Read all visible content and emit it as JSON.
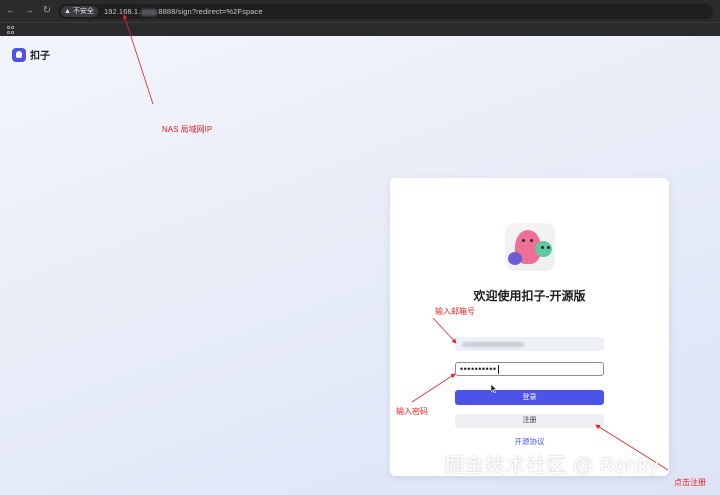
{
  "browser": {
    "insecure_label": "不安全",
    "url_prefix": "192.168.1.",
    "url_suffix": "8888/sign?redirect=%2Fspace"
  },
  "brand": {
    "name": "扣子"
  },
  "login": {
    "title": "欢迎使用扣子-开源版",
    "password_mask": "••••••••••",
    "login_label": "登录",
    "register_label": "注册",
    "license_label": "开源协议"
  },
  "annotations": {
    "nas": "NAS 局域网IP",
    "email": "输入邮箱号",
    "password": "输入密码",
    "register": "点击注册",
    "color": "#e02424"
  },
  "watermark": "掘金技术社区 @ Ronky",
  "colors": {
    "accent": "#4d53e8",
    "chrome": "#2b2b2e"
  },
  "icons": [
    "back-arrow-icon",
    "forward-arrow-icon",
    "reload-icon",
    "warning-icon",
    "apps-grid-icon",
    "brand-logo-icon",
    "mascot-illustration"
  ]
}
